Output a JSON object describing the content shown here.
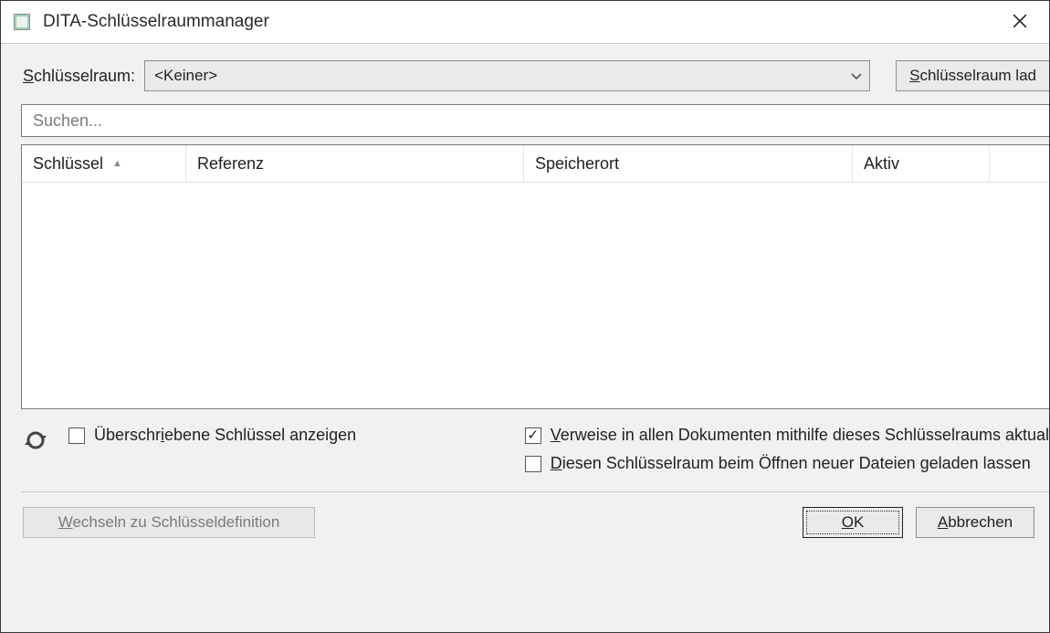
{
  "window": {
    "title": "DITA-Schlüsselraummanager"
  },
  "keyspace": {
    "label_pre": "S",
    "label_rest": "chlüsselraum:",
    "selected": "<Keiner>",
    "load_btn_pre": "S",
    "load_btn_rest": "chlüsselraum lad"
  },
  "search": {
    "placeholder": "Suchen..."
  },
  "table": {
    "columns": {
      "key": "Schlüssel",
      "ref": "Referenz",
      "loc": "Speicherort",
      "active": "Aktiv"
    },
    "sort_indicator": "▲"
  },
  "options": {
    "show_overridden_pre": "Überschr",
    "show_overridden_u": "i",
    "show_overridden_post": "ebene Schlüssel anzeigen",
    "update_refs_pre": "V",
    "update_refs_rest": "erweise in allen Dokumenten mithilfe dieses Schlüsselraums aktual",
    "keep_loaded_pre": "D",
    "keep_loaded_rest": "iesen Schlüsselraum beim Öffnen neuer Dateien geladen lassen"
  },
  "buttons": {
    "go_def_pre": "W",
    "go_def_rest": "echseln zu Schlüsseldefinition",
    "ok_pre": "O",
    "ok_rest": "K",
    "cancel_pre": "A",
    "cancel_rest": "bbrechen"
  },
  "state": {
    "show_overridden": false,
    "update_refs": true,
    "keep_loaded": false
  }
}
